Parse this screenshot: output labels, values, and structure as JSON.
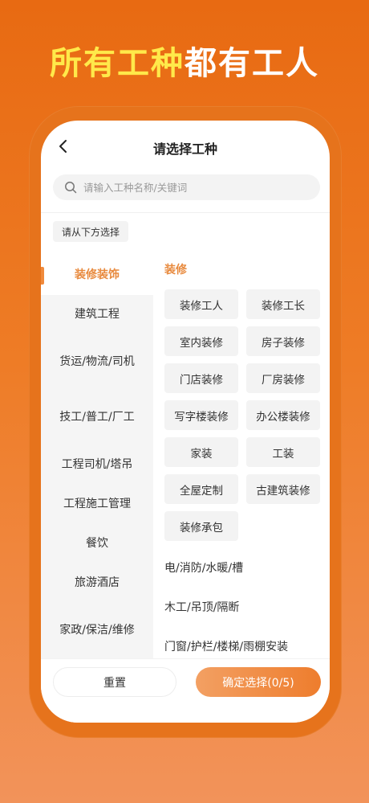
{
  "headline": {
    "highlight": "所有工种",
    "rest": "都有工人"
  },
  "nav": {
    "title": "请选择工种",
    "back_icon": "chevron-left-icon"
  },
  "search": {
    "placeholder": "请输入工种名称/关键词",
    "value": "",
    "icon": "search-icon"
  },
  "hint": "请从下方选择",
  "categories": [
    {
      "label": "装修装饰",
      "active": true
    },
    {
      "label": "建筑工程"
    },
    {
      "label": "货运/物流/司机"
    },
    {
      "label": "技工/普工/厂工"
    },
    {
      "label": "工程司机/塔吊"
    },
    {
      "label": "工程施工管理"
    },
    {
      "label": "餐饮"
    },
    {
      "label": "旅游酒店"
    },
    {
      "label": "家政/保洁/维修"
    }
  ],
  "section": {
    "title": "装修",
    "chips": [
      "装修工人",
      "装修工长",
      "室内装修",
      "房子装修",
      "门店装修",
      "厂房装修",
      "写字楼装修",
      "办公楼装修",
      "家装",
      "工装",
      "全屋定制",
      "古建筑装修",
      "装修承包"
    ]
  },
  "subcategories": [
    "电/消防/水暖/槽",
    "木工/吊顶/隔断",
    "门窗/护栏/楼梯/雨棚安装"
  ],
  "footer": {
    "reset": "重置",
    "confirm": "确定选择(0/5)"
  },
  "colors": {
    "accent": "#E88A3E",
    "brand_orange": "#E86A12",
    "headline_yellow": "#FFE94A"
  }
}
